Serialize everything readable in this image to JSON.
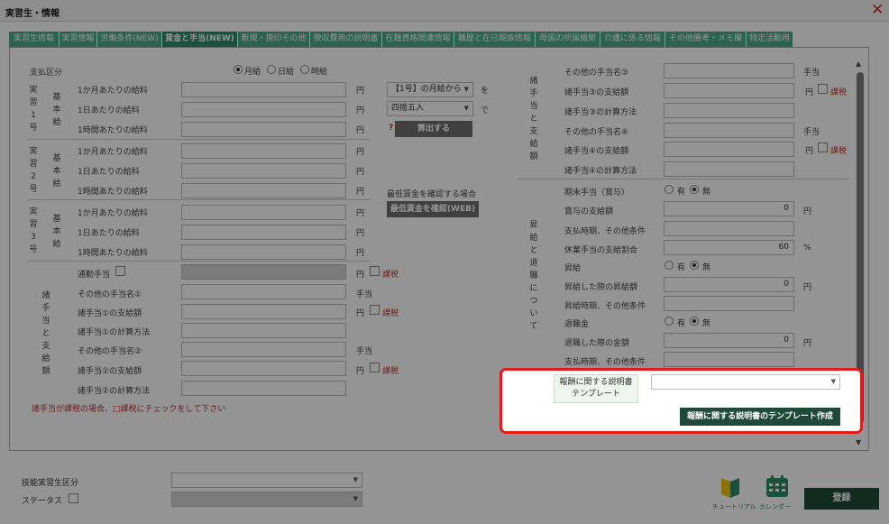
{
  "window": {
    "title": "実習生・情報"
  },
  "tabs": [
    {
      "label": "実習生情報"
    },
    {
      "label": "実習情報"
    },
    {
      "label": "労働条件(NEW)"
    },
    {
      "label": "賃金と手当(NEW)"
    },
    {
      "label": "新規・捺印その他"
    },
    {
      "label": "徴収費用の説明書"
    },
    {
      "label": "在籍資格関連情報"
    },
    {
      "label": "職歴と在日親族情報"
    },
    {
      "label": "母国の所属機関"
    },
    {
      "label": "介護に係る情報"
    },
    {
      "label": "その他備考・メモ欄"
    },
    {
      "label": "特定活動用"
    }
  ],
  "payment": {
    "label": "支払区分",
    "options": [
      {
        "label": "月給"
      },
      {
        "label": "日給"
      },
      {
        "label": "時給"
      }
    ]
  },
  "units": {
    "yen": "円",
    "allowance": "手当",
    "percent": "%"
  },
  "groups": {
    "g1": {
      "v1": "実習1号",
      "v2": "基本給"
    },
    "g2": {
      "v1": "実習2号",
      "v2": "基本給"
    },
    "g3": {
      "v1": "実習3号",
      "v2": "基本給"
    },
    "allow": {
      "v": "諸手当と支給額"
    },
    "rallow": {
      "v": "諸手当と支給額"
    },
    "bonus": {
      "v": "昇給と退職について"
    }
  },
  "rows": {
    "monthly": "1か月あたりの給料",
    "daily": "1日あたりの給料",
    "hourly": "1時間あたりの給料"
  },
  "calc": {
    "basis": "【1号】の月給から",
    "basis_suffix": "を",
    "rounding": "四捨五入",
    "rounding_suffix": "で",
    "help": "?",
    "button": "算出する"
  },
  "minwage": {
    "label": "最低賃金を確認する場合",
    "button": "最低賃金を確認(WEB)"
  },
  "allow": {
    "commute": "通勤手当",
    "tax": "課税",
    "name1": "その他の手当名①",
    "amt1": "諸手当①の支給額",
    "calc1": "諸手当①の計算方法",
    "name2": "その他の手当名②",
    "amt2": "諸手当②の支給額",
    "calc2": "諸手当②の計算方法",
    "note": "諸手当が課税の場合、□課税にチェックをして下さい"
  },
  "rallow": {
    "name3": "その他の手当名③",
    "amt3": "諸手当③の支給額",
    "calc3": "諸手当③の計算方法",
    "name4": "その他の手当名④",
    "amt4": "諸手当④の支給額",
    "calc4": "諸手当④の計算方法"
  },
  "bonus": {
    "label": "期末手当（賞与）",
    "yes": "有",
    "no": "無",
    "amount_label": "賞与の支給額",
    "amount": "0",
    "timing": "支払時期、その他条件",
    "leave_label": "休業手当の支給割合",
    "leave": "60",
    "raise_label": "昇給",
    "raise_amt_label": "昇給した際の昇給額",
    "raise_amt": "0",
    "raise_timing": "昇給時期、その他条件",
    "retire_label": "退職金",
    "retire_amt_label": "退職した際の金額",
    "retire_amt": "0",
    "retire_timing": "支払時期、その他条件"
  },
  "template": {
    "label1": "報酬に関する説明書",
    "label2": "テンプレート",
    "select": "",
    "button": "報酬に関する説明書のテンプレート作成"
  },
  "footer": {
    "class_label": "技能実習生区分",
    "status_label": "ステータス",
    "tutorial": "チュートリアル",
    "calendar": "カレンダー",
    "register": "登録"
  },
  "colors": {
    "tab": "#4caa8a",
    "tab_active": "#2e8c6a",
    "highlight": "#e21c1c",
    "tax": "#c03030"
  }
}
